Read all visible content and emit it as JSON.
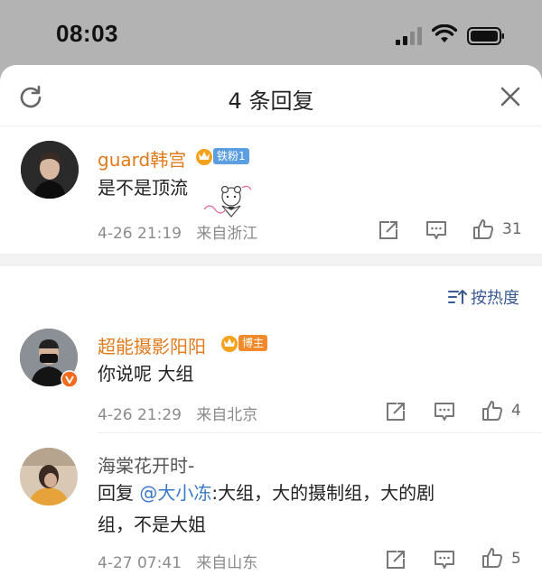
{
  "status_bar": {
    "time": "08:03"
  },
  "header": {
    "title": "4 条回复"
  },
  "root_comment": {
    "username": "guard韩宫",
    "badge": "铁粉1",
    "text": "是不是顶流",
    "date": "4-26 21:19",
    "location": "来自浙江",
    "likes": "31"
  },
  "sort": {
    "label": "按热度"
  },
  "replies": [
    {
      "username": "超能摄影阳阳",
      "badge": "博主",
      "text": "你说呢 大组",
      "date": "4-26 21:29",
      "location": "来自北京",
      "likes": "4"
    },
    {
      "username": "海棠花开时-",
      "reply_prefix": "回复",
      "mention": "@大小冻",
      "text_line1": ":大组，大的摄制组，大的剧",
      "text_line2": "组，不是大姐",
      "date": "4-27 07:41",
      "location": "来自山东",
      "likes": "5"
    }
  ]
}
